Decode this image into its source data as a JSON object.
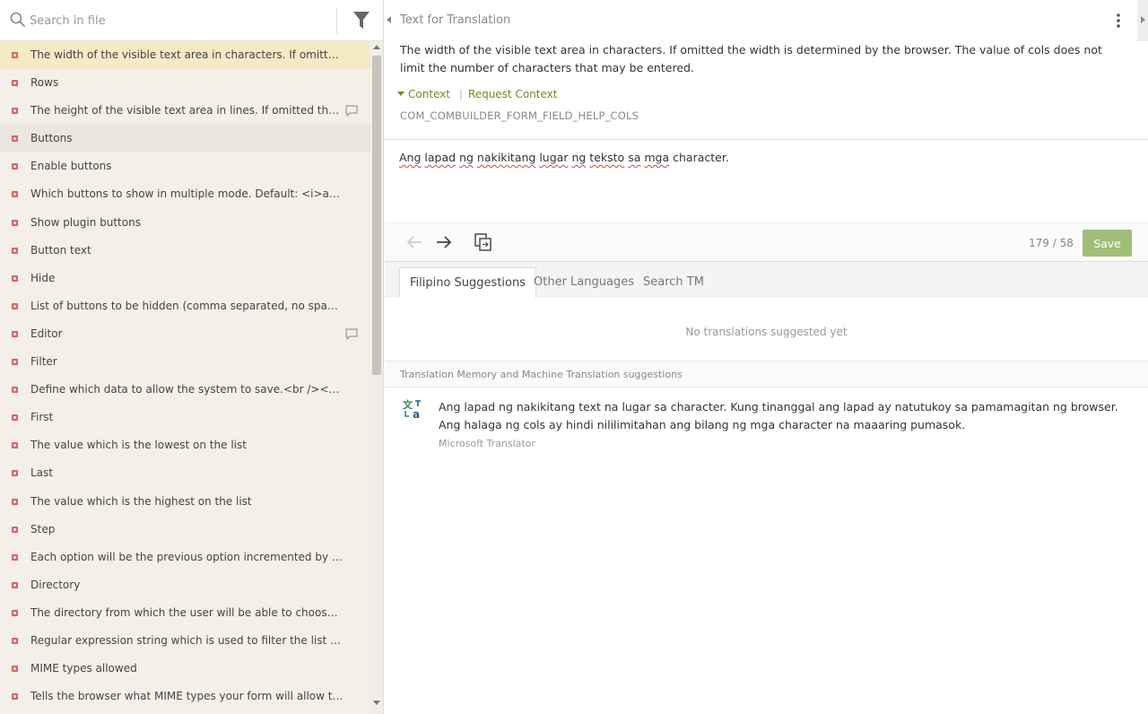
{
  "search": {
    "placeholder": "Search in file"
  },
  "strings": [
    {
      "text": "The width of the visible text area in characters. If omitted the width is determined by the browser. The value of cols does not limit the number of characters that may be entered.",
      "state": "active",
      "comment": false
    },
    {
      "text": "Rows",
      "state": "",
      "comment": false
    },
    {
      "text": "The height of the visible text area in lines. If omitted the width is determined by the browser.",
      "state": "",
      "comment": true
    },
    {
      "text": "Buttons",
      "state": "hover",
      "comment": false
    },
    {
      "text": "Enable buttons",
      "state": "",
      "comment": false
    },
    {
      "text": "Which buttons to show in multiple mode. Default: <i>add, remove, move</i>",
      "state": "",
      "comment": false
    },
    {
      "text": "Show plugin buttons",
      "state": "",
      "comment": false
    },
    {
      "text": "Button text",
      "state": "",
      "comment": false
    },
    {
      "text": "Hide",
      "state": "",
      "comment": false
    },
    {
      "text": "List of buttons to be hidden (comma separated, no space).",
      "state": "",
      "comment": false
    },
    {
      "text": "Editor",
      "state": "",
      "comment": true
    },
    {
      "text": "Filter",
      "state": "",
      "comment": false
    },
    {
      "text": "Define which data to allow the system to save.<br /><br /><strong>",
      "state": "",
      "comment": false
    },
    {
      "text": "First",
      "state": "",
      "comment": false
    },
    {
      "text": "The value which is the lowest on the list",
      "state": "",
      "comment": false
    },
    {
      "text": "Last",
      "state": "",
      "comment": false
    },
    {
      "text": "The value which is the highest on the list",
      "state": "",
      "comment": false
    },
    {
      "text": "Step",
      "state": "",
      "comment": false
    },
    {
      "text": "Each option will be the previous option incremented by this integer.",
      "state": "",
      "comment": false
    },
    {
      "text": "Directory",
      "state": "",
      "comment": false
    },
    {
      "text": "The directory from which the user will be able to choose a file. This",
      "state": "",
      "comment": false
    },
    {
      "text": "Regular expression string which is used to filter the list of files selected",
      "state": "",
      "comment": false
    },
    {
      "text": "MIME types allowed",
      "state": "",
      "comment": false
    },
    {
      "text": "Tells the browser what MIME types your form will allow to be uploaded",
      "state": "",
      "comment": false
    }
  ],
  "source": {
    "title": "Text for Translation",
    "text": "The width of the visible text area in characters. If omitted the width is determined by the browser. The value of cols does not limit the number of characters that may be entered.",
    "context_label": "Context",
    "request_context_label": "Request Context",
    "key": "COM_COMBUILDER_FORM_FIELD_HELP_COLS"
  },
  "translation": {
    "value": "Ang lapad ng nakikitang lugar ng teksto sa mga character."
  },
  "toolbar": {
    "counter": "179 / 58",
    "save_label": "Save"
  },
  "tabs": [
    {
      "label": "Filipino Suggestions"
    },
    {
      "label": "Other Languages"
    },
    {
      "label": "Search TM"
    }
  ],
  "suggestions": {
    "empty_text": "No translations suggested yet",
    "mt_section_title": "Translation Memory and Machine Translation suggestions",
    "mt_text": "Ang lapad ng nakikitang text na lugar sa character. Kung tinanggal ang lapad ay natutukoy sa pamamagitan ng browser. Ang halaga ng cols ay hindi nililimitahan ang bilang ng mga character na maaaring pumasok.",
    "mt_source": "Microsoft Translator"
  },
  "colors": {
    "accent_green": "#6a8f1f",
    "save_button": "#9fbf78",
    "active_row": "#f6e9c6",
    "untranslated_dot": "#e06060"
  }
}
